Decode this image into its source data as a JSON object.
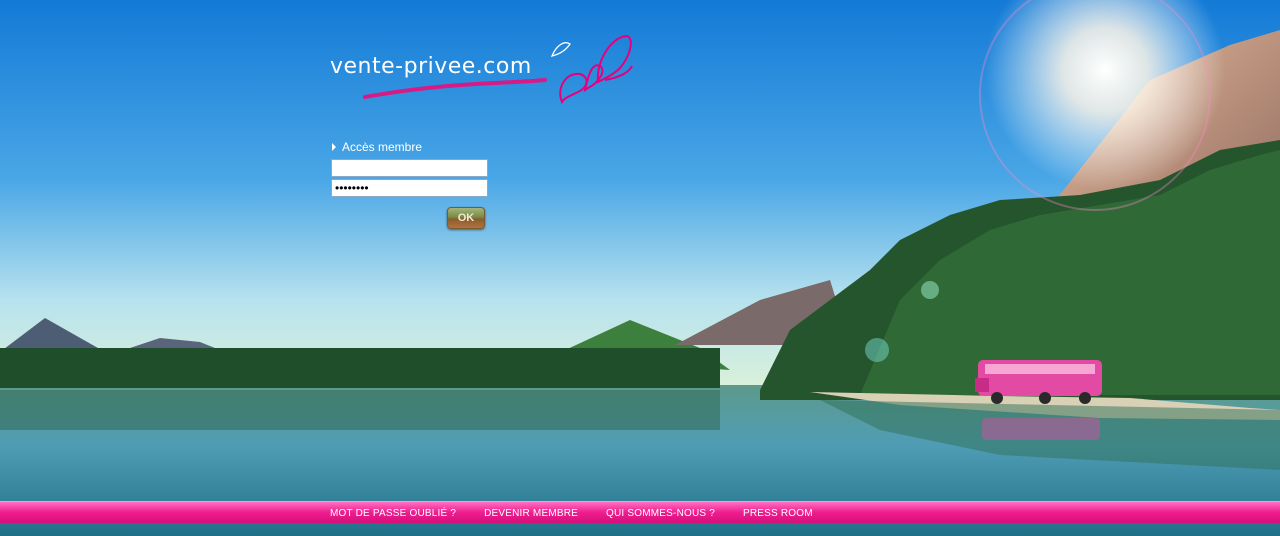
{
  "brand": {
    "logo_text": "vente-privee.com"
  },
  "login": {
    "title": "Accès membre",
    "username_value": "",
    "password_value": "••••••••",
    "submit_label": "OK"
  },
  "footer": {
    "links": [
      "MOT DE PASSE OUBLIÉ ?",
      "DEVENIR MEMBRE",
      "QUI SOMMES-NOUS ?",
      "PRESS ROOM"
    ]
  },
  "colors": {
    "brand_pink": "#e6007e",
    "footer_pink": "#ef1d8f",
    "sky_blue": "#1f7fd0"
  }
}
